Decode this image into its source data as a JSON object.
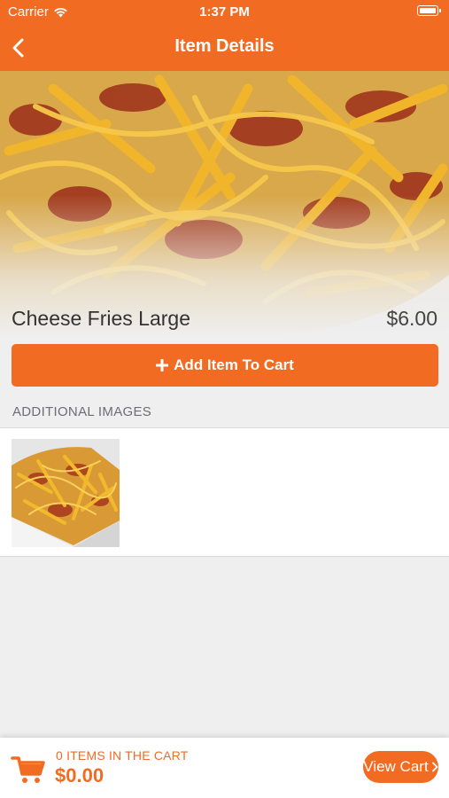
{
  "status_bar": {
    "carrier": "Carrier",
    "time": "1:37 PM"
  },
  "nav": {
    "title": "Item Details",
    "back_icon": "chevron-left-icon"
  },
  "item": {
    "name": "Cheese Fries Large",
    "price": "$6.00",
    "add_label": "Add Item To Cart",
    "add_icon": "plus-icon"
  },
  "additional_images": {
    "header": "ADDITIONAL IMAGES"
  },
  "cart": {
    "items_label": "0 ITEMS IN THE CART",
    "total": "$0.00",
    "view_label": "View Cart",
    "view_icon": "chevron-right-icon",
    "cart_icon": "shopping-cart-icon"
  },
  "colors": {
    "accent": "#f26b22",
    "background": "#efeff0",
    "text_dark": "#333333",
    "section_header": "#6d6d72"
  }
}
